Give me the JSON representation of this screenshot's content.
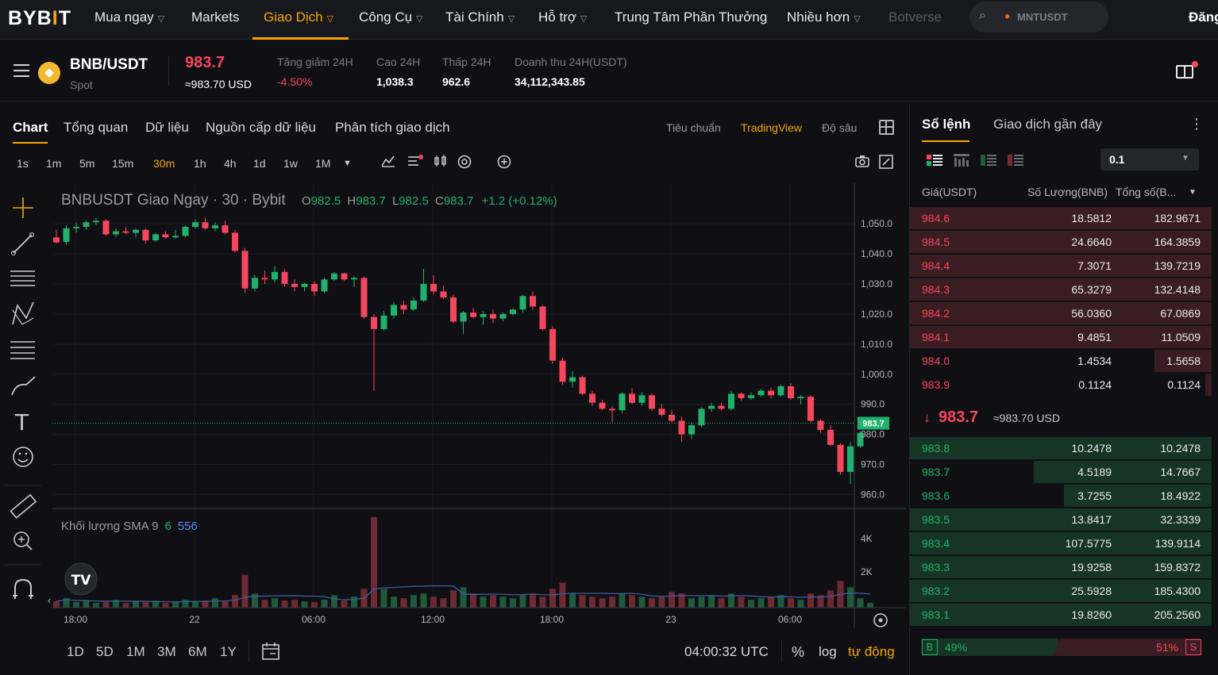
{
  "nav": {
    "logo_a": "BYB",
    "logo_dot": "I",
    "logo_b": "T",
    "items": [
      "Mua ngay",
      "Markets",
      "Giao Dịch",
      "Công Cụ",
      "Tài Chính",
      "Hỗ trợ",
      "Trung Tâm Phần Thưởng",
      "Nhiều hơn",
      "Botverse"
    ],
    "search_placeholder": "MNTUSDT",
    "login": "Đăng"
  },
  "ticker": {
    "pair": "BNB/USDT",
    "type": "Spot",
    "price": "983.7",
    "price_usd": "≈983.70 USD",
    "change_label": "Tăng giảm 24H",
    "change_value": "-4.50%",
    "high_label": "Cao 24H",
    "high_value": "1,038.3",
    "low_label": "Thấp 24H",
    "low_value": "962.6",
    "turnover_label": "Doanh thu 24H(USDT)",
    "turnover_value": "34,112,343.85"
  },
  "chart_tabs": [
    "Chart",
    "Tổng quan",
    "Dữ liệu",
    "Nguồn cấp dữ liệu",
    "Phân tích giao dịch"
  ],
  "view_tabs": [
    "Tiêu chuẩn",
    "TradingView",
    "Độ sâu"
  ],
  "timeframes": [
    "1s",
    "1m",
    "5m",
    "15m",
    "30m",
    "1h",
    "4h",
    "1d",
    "1w",
    "1M"
  ],
  "legend": {
    "title": "BNBUSDT Giao Ngay · 30 · Bybit",
    "o": "982.5",
    "h": "983.7",
    "l": "982.5",
    "c": "983.7",
    "chg": "+1.2 (+0.12%)",
    "vol_label": "Khối lượng SMA 9",
    "vol_a": "6",
    "vol_b": "556"
  },
  "price_axis": [
    "1,050.0",
    "1,040.0",
    "1,030.0",
    "1,020.0",
    "1,010.0",
    "1,000.0",
    "990.0",
    "980.0",
    "970.0",
    "960.0"
  ],
  "price_tag": "983.7",
  "vol_axis": [
    "4K",
    "2K"
  ],
  "time_axis": [
    "18:00",
    "22",
    "06:00",
    "12:00",
    "18:00",
    "23",
    "06:00"
  ],
  "range_buttons": [
    "1D",
    "5D",
    "1M",
    "3M",
    "6M",
    "1Y"
  ],
  "clock": "04:00:32 UTC",
  "pct_label": "%",
  "log_label": "log",
  "auto_label": "tự động",
  "colors": {
    "up": "#20b26c",
    "down": "#f6465d",
    "accent": "#f7a600"
  },
  "chart_data": {
    "type": "candlestick",
    "title": "BNBUSDT Giao Ngay · 30 · Bybit",
    "ylim": [
      958,
      1054
    ],
    "candles": [
      [
        1045.5,
        1048.0,
        1043.5,
        1043.8
      ],
      [
        1044.0,
        1049.5,
        1043.0,
        1048.5
      ],
      [
        1048.5,
        1050.5,
        1047.0,
        1049.0
      ],
      [
        1049.0,
        1051.0,
        1048.0,
        1050.5
      ],
      [
        1050.5,
        1052.0,
        1049.5,
        1051.0
      ],
      [
        1051.0,
        1051.5,
        1046.0,
        1046.5
      ],
      [
        1046.5,
        1048.5,
        1045.5,
        1047.5
      ],
      [
        1047.5,
        1049.0,
        1046.5,
        1047.0
      ],
      [
        1047.0,
        1048.5,
        1045.5,
        1048.0
      ],
      [
        1048.0,
        1048.5,
        1043.5,
        1044.5
      ],
      [
        1044.5,
        1047.0,
        1044.0,
        1046.5
      ],
      [
        1046.5,
        1047.5,
        1045.0,
        1045.5
      ],
      [
        1045.5,
        1048.0,
        1045.0,
        1046.0
      ],
      [
        1046.0,
        1049.5,
        1045.5,
        1049.0
      ],
      [
        1049.0,
        1051.5,
        1048.5,
        1050.5
      ],
      [
        1050.5,
        1052.0,
        1048.0,
        1048.5
      ],
      [
        1048.5,
        1050.5,
        1047.5,
        1049.5
      ],
      [
        1049.5,
        1051.0,
        1046.5,
        1047.0
      ],
      [
        1047.0,
        1048.0,
        1040.5,
        1041.0
      ],
      [
        1041.0,
        1042.0,
        1027.0,
        1028.5
      ],
      [
        1028.5,
        1033.0,
        1027.5,
        1032.0
      ],
      [
        1032.0,
        1034.5,
        1030.0,
        1031.5
      ],
      [
        1031.5,
        1036.0,
        1030.5,
        1034.0
      ],
      [
        1034.0,
        1035.0,
        1029.0,
        1030.0
      ],
      [
        1030.0,
        1031.5,
        1027.5,
        1029.0
      ],
      [
        1029.0,
        1030.5,
        1027.5,
        1030.0
      ],
      [
        1030.0,
        1031.0,
        1026.0,
        1027.5
      ],
      [
        1027.5,
        1032.0,
        1027.0,
        1031.5
      ],
      [
        1031.5,
        1034.0,
        1031.0,
        1033.5
      ],
      [
        1033.5,
        1033.8,
        1031.0,
        1031.5
      ],
      [
        1031.5,
        1032.5,
        1029.0,
        1032.0
      ],
      [
        1032.0,
        1032.5,
        1018.5,
        1019.0
      ],
      [
        1019.0,
        1020.0,
        994.5,
        1015.0
      ],
      [
        1015.0,
        1021.0,
        1014.5,
        1019.5
      ],
      [
        1019.5,
        1024.0,
        1018.5,
        1023.0
      ],
      [
        1023.0,
        1024.5,
        1020.0,
        1021.5
      ],
      [
        1021.5,
        1025.5,
        1021.0,
        1024.5
      ],
      [
        1024.5,
        1035.0,
        1024.0,
        1030.0
      ],
      [
        1030.0,
        1033.0,
        1026.5,
        1027.5
      ],
      [
        1027.5,
        1029.5,
        1025.0,
        1025.5
      ],
      [
        1025.5,
        1026.5,
        1017.0,
        1017.5
      ],
      [
        1017.5,
        1021.0,
        1013.5,
        1020.5
      ],
      [
        1020.5,
        1022.0,
        1018.5,
        1019.0
      ],
      [
        1019.0,
        1021.0,
        1016.5,
        1020.0
      ],
      [
        1020.0,
        1021.5,
        1017.0,
        1018.5
      ],
      [
        1018.5,
        1020.5,
        1017.5,
        1020.0
      ],
      [
        1020.0,
        1022.0,
        1019.5,
        1021.5
      ],
      [
        1021.5,
        1026.5,
        1020.5,
        1026.0
      ],
      [
        1026.0,
        1027.5,
        1021.5,
        1022.5
      ],
      [
        1022.5,
        1023.0,
        1014.5,
        1015.0
      ],
      [
        1015.0,
        1016.0,
        1003.5,
        1004.5
      ],
      [
        1004.5,
        1005.5,
        996.5,
        997.5
      ],
      [
        997.5,
        1001.0,
        995.5,
        999.0
      ],
      [
        999.0,
        999.5,
        993.0,
        993.5
      ],
      [
        993.5,
        994.5,
        989.5,
        990.5
      ],
      [
        990.5,
        991.5,
        988.0,
        988.5
      ],
      [
        988.5,
        989.5,
        984.0,
        988.0
      ],
      [
        988.0,
        994.0,
        987.0,
        993.5
      ],
      [
        993.5,
        995.5,
        990.0,
        990.5
      ],
      [
        990.5,
        994.0,
        989.5,
        993.0
      ],
      [
        993.0,
        993.5,
        988.0,
        988.5
      ],
      [
        988.5,
        990.0,
        986.0,
        986.5
      ],
      [
        986.5,
        988.0,
        984.0,
        984.5
      ],
      [
        984.5,
        986.0,
        977.5,
        980.0
      ],
      [
        980.0,
        984.0,
        978.5,
        983.0
      ],
      [
        983.0,
        989.0,
        982.5,
        988.5
      ],
      [
        988.5,
        990.5,
        987.5,
        989.5
      ],
      [
        989.5,
        990.5,
        988.0,
        988.5
      ],
      [
        988.5,
        994.5,
        988.0,
        993.5
      ],
      [
        993.5,
        994.0,
        991.0,
        992.0
      ],
      [
        992.0,
        994.0,
        991.5,
        993.0
      ],
      [
        993.0,
        995.0,
        992.5,
        994.5
      ],
      [
        994.5,
        995.5,
        992.0,
        993.0
      ],
      [
        993.0,
        996.5,
        992.5,
        996.0
      ],
      [
        996.0,
        997.0,
        991.5,
        992.0
      ],
      [
        992.0,
        993.0,
        990.0,
        992.5
      ],
      [
        992.5,
        993.0,
        984.0,
        984.5
      ],
      [
        984.5,
        985.0,
        980.5,
        981.5
      ],
      [
        981.5,
        983.0,
        976.0,
        976.5
      ],
      [
        976.5,
        977.0,
        966.5,
        967.5
      ],
      [
        967.5,
        977.5,
        963.5,
        976.0
      ],
      [
        976.0,
        981.0,
        975.5,
        980.5
      ],
      [
        982.5,
        983.7,
        982.5,
        983.7
      ]
    ],
    "volume": [
      400,
      600,
      350,
      450,
      300,
      350,
      500,
      300,
      400,
      350,
      450,
      300,
      350,
      500,
      400,
      450,
      600,
      400,
      800,
      2100,
      900,
      500,
      600,
      450,
      500,
      400,
      350,
      500,
      800,
      450,
      700,
      1200,
      5800,
      1200,
      700,
      600,
      800,
      900,
      700,
      600,
      1100,
      1300,
      900,
      700,
      800,
      700,
      600,
      800,
      900,
      700,
      1200,
      1600,
      900,
      800,
      700,
      600,
      700,
      900,
      800,
      700,
      600,
      700,
      1000,
      900,
      600,
      700,
      800,
      600,
      900,
      700,
      500,
      600,
      700,
      800,
      600,
      500,
      900,
      800,
      1100,
      1700,
      1300,
      600,
      300
    ]
  },
  "orderbook": {
    "tab_active": "Sổ lệnh",
    "tab_other": "Giao dịch gần đây",
    "tick": "0.1",
    "headers": {
      "price": "Giá(USDT)",
      "qty": "Số Lượng(BNB)",
      "total": "Tổng số(B..."
    },
    "asks": [
      {
        "price": "984.6",
        "qty": "18.5812",
        "total": "182.9671",
        "depth": 1.0
      },
      {
        "price": "984.5",
        "qty": "24.6640",
        "total": "164.3859",
        "depth": 1.0
      },
      {
        "price": "984.4",
        "qty": "7.3071",
        "total": "139.7219",
        "depth": 1.0
      },
      {
        "price": "984.3",
        "qty": "65.3279",
        "total": "132.4148",
        "depth": 1.0
      },
      {
        "price": "984.2",
        "qty": "56.0360",
        "total": "67.0869",
        "depth": 1.0
      },
      {
        "price": "984.1",
        "qty": "9.4851",
        "total": "11.0509",
        "depth": 1.0
      },
      {
        "price": "984.0",
        "qty": "1.4534",
        "total": "1.5658",
        "depth": 0.19
      },
      {
        "price": "983.9",
        "qty": "0.1124",
        "total": "0.1124",
        "depth": 0.02
      }
    ],
    "mid_arrow": "↓",
    "mid_price": "983.7",
    "mid_usd": "≈983.70 USD",
    "bids": [
      {
        "price": "983.8",
        "qty": "10.2478",
        "total": "10.2478",
        "depth": 1.0
      },
      {
        "price": "983.7",
        "qty": "4.5189",
        "total": "14.7667",
        "depth": 0.59
      },
      {
        "price": "983.6",
        "qty": "3.7255",
        "total": "18.4922",
        "depth": 0.49
      },
      {
        "price": "983.5",
        "qty": "13.8417",
        "total": "32.3339",
        "depth": 1.0
      },
      {
        "price": "983.4",
        "qty": "107.5775",
        "total": "139.9114",
        "depth": 1.0
      },
      {
        "price": "983.3",
        "qty": "19.9258",
        "total": "159.8372",
        "depth": 1.0
      },
      {
        "price": "983.2",
        "qty": "25.5928",
        "total": "185.4300",
        "depth": 1.0
      },
      {
        "price": "983.1",
        "qty": "19.8260",
        "total": "205.2560",
        "depth": 1.0
      }
    ],
    "buy_label": "B",
    "buy_pct": "49%",
    "sell_label": "S",
    "sell_pct": "51%"
  }
}
